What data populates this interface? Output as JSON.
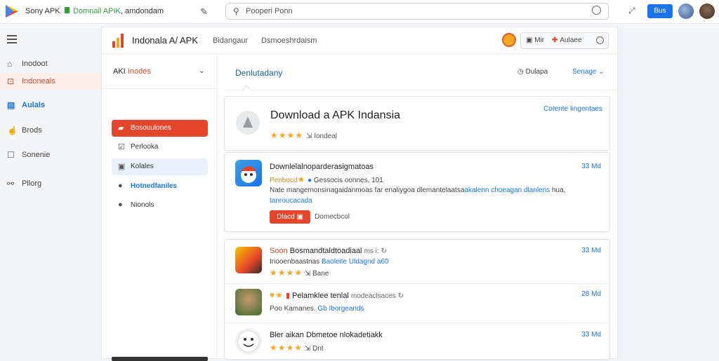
{
  "browser": {
    "app_name": "Sony APK",
    "url_green": "Domnail APIK",
    "url_dark": ", amdondam",
    "search_placeholder": "Pooperi Ponn",
    "button_label": "Bus"
  },
  "left_nav": {
    "items": [
      {
        "label": "Inodoot",
        "icon": "home-icon",
        "state": "normal"
      },
      {
        "label": "Indoneals",
        "icon": "download-icon",
        "state": "active"
      },
      {
        "label": "Aulals",
        "icon": "apps-icon",
        "state": "blue"
      },
      {
        "label": "Brods",
        "icon": "bookmark-icon",
        "state": "normal"
      },
      {
        "label": "Sonenie",
        "icon": "doc-icon",
        "state": "normal"
      },
      {
        "label": "Pllorg",
        "icon": "link-icon",
        "state": "normal"
      }
    ]
  },
  "panel": {
    "title": "Indonala A/ APK",
    "tabs": [
      "Bidangaur",
      "Dsmoeshrdaism"
    ],
    "controls": {
      "c1": "Mir",
      "c2": "Aulaee"
    }
  },
  "filter": {
    "label_a": "AKI",
    "label_b": "Inodes",
    "items": [
      {
        "label": "Bosouulones",
        "icon": "flag-icon",
        "style": "red"
      },
      {
        "label": "Perlooka",
        "icon": "edit-icon",
        "style": "plain"
      },
      {
        "label": "Kolales",
        "icon": "box-icon",
        "style": "bluebg"
      },
      {
        "label": "Hotnedfaniles",
        "icon": "dot-icon",
        "style": "blue"
      },
      {
        "label": "Nionols",
        "icon": "dot-icon",
        "style": "plain"
      }
    ]
  },
  "content": {
    "title": "Denlutadany",
    "right1": "Dulapa",
    "right2": "Senage",
    "hero": {
      "title": "Download a APK Indansia",
      "rating_text": "Iondeal",
      "link": "Cotente Iingentaes"
    },
    "featured": {
      "title": "Downlelalnoparderasigmatoas",
      "size": "33 Md",
      "meta_gold": "Penbocd",
      "meta_rest": "Gessocis oonnes, 101",
      "desc_a": "Nate mangemonsinagaidanmoas far enaliygoa dlemantelaatsa",
      "desc_blue": "akalenn choeagan dlanlens",
      "desc_end": "hua,",
      "desc_line2": "tanroucacada",
      "button": "Dlacd",
      "note": "Domecbcol"
    },
    "rows": [
      {
        "title_red": "Soon",
        "title": "Bosmandtaldtoadiaal",
        "title_muted": "ms i:",
        "size": "33 Md",
        "line_a": "Inooenbaastnas",
        "line_blue": "Baoleite Uldagnd a60"
      },
      {
        "title": "Pelamklee tenlal",
        "title_muted": "modeaclsaces",
        "size": "28 Md",
        "line_a": "Poo Kamanes.",
        "line_blue": "Gb Iborgeands"
      },
      {
        "title": "Bler aikan Dbmetoe nlokadetiakk",
        "size": "33 Md",
        "line_a": "Dnt"
      }
    ]
  },
  "colors": {
    "accent_red": "#e5452a",
    "accent_blue": "#1a73e8",
    "star": "#f5a623"
  }
}
